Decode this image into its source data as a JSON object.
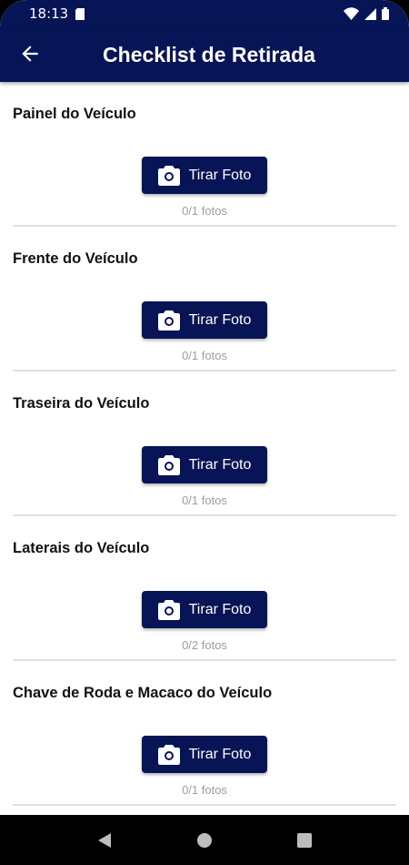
{
  "status": {
    "time": "18:13"
  },
  "header": {
    "title": "Checklist de Retirada"
  },
  "sections": [
    {
      "title": "Painel do Veículo",
      "button": "Tirar Foto",
      "count": "0/1 fotos"
    },
    {
      "title": "Frente do Veículo",
      "button": "Tirar Foto",
      "count": "0/1 fotos"
    },
    {
      "title": "Traseira do Veículo",
      "button": "Tirar Foto",
      "count": "0/1 fotos"
    },
    {
      "title": "Laterais do Veículo",
      "button": "Tirar Foto",
      "count": "0/2 fotos"
    },
    {
      "title": "Chave de Roda e Macaco do Veículo",
      "button": "Tirar Foto",
      "count": "0/1 fotos"
    }
  ],
  "icons": {
    "back": "arrow-left-icon",
    "camera": "camera-icon"
  },
  "colors": {
    "primary": "#071455",
    "muted": "#9e9e9e"
  }
}
